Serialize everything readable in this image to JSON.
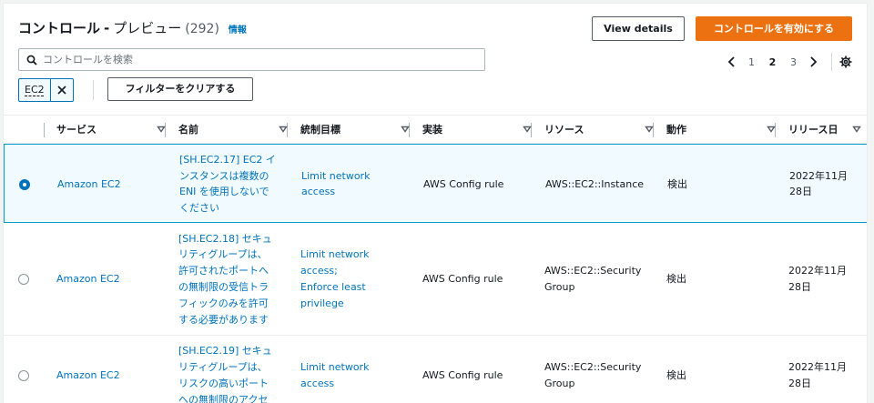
{
  "header": {
    "title": "コントロール",
    "separator": "-",
    "subtitle": "プレビュー",
    "count": "(292)",
    "info_label": "情報",
    "view_details_label": "View details",
    "enable_label": "コントロールを有効にする"
  },
  "search": {
    "placeholder": "コントロールを検索",
    "value": ""
  },
  "pagination": {
    "pages": [
      "1",
      "2",
      "3"
    ],
    "current_page": "2",
    "icons": [
      "chevron-left-icon",
      "chevron-right-icon",
      "gear-icon"
    ]
  },
  "filter": {
    "token_label": "EC2",
    "clear_label": "フィルターをクリアする"
  },
  "table": {
    "columns": [
      "サービス",
      "名前",
      "統制目標",
      "実装",
      "リソース",
      "動作",
      "リリース日"
    ],
    "rows": [
      {
        "selected": true,
        "service": "Amazon EC2",
        "name": [
          "[SH.EC2.17] EC2 イ",
          "ンスタンスは複数の",
          "ENI を使用しないで",
          "ください"
        ],
        "objective": [
          "Limit network",
          "access"
        ],
        "implementation": "AWS Config rule",
        "resource": [
          "AWS::EC2::Instance"
        ],
        "behavior": "検出",
        "release": [
          "2022年11月",
          "28日"
        ]
      },
      {
        "selected": false,
        "service": "Amazon EC2",
        "name": [
          "[SH.EC2.18] セキュ",
          "リティグループは、",
          "許可されたポートへ",
          "の無制限の受信トラ",
          "フィックのみを許可",
          "する必要があります"
        ],
        "objective": [
          "Limit network",
          "access;",
          "Enforce least",
          "privilege"
        ],
        "implementation": "AWS Config rule",
        "resource": [
          "AWS::EC2::Security",
          "Group"
        ],
        "behavior": "検出",
        "release": [
          "2022年11月",
          "28日"
        ]
      },
      {
        "selected": false,
        "service": "Amazon EC2",
        "name": [
          "[SH.EC2.19] セキュ",
          "リティグループは、",
          "リスクの高いポート",
          "への無制限のアクセ"
        ],
        "objective": [
          "Limit network",
          "access"
        ],
        "implementation": "AWS Config rule",
        "resource": [
          "AWS::EC2::Security",
          "Group"
        ],
        "behavior": "検出",
        "release": [
          "2022年11月",
          "28日"
        ]
      }
    ]
  }
}
